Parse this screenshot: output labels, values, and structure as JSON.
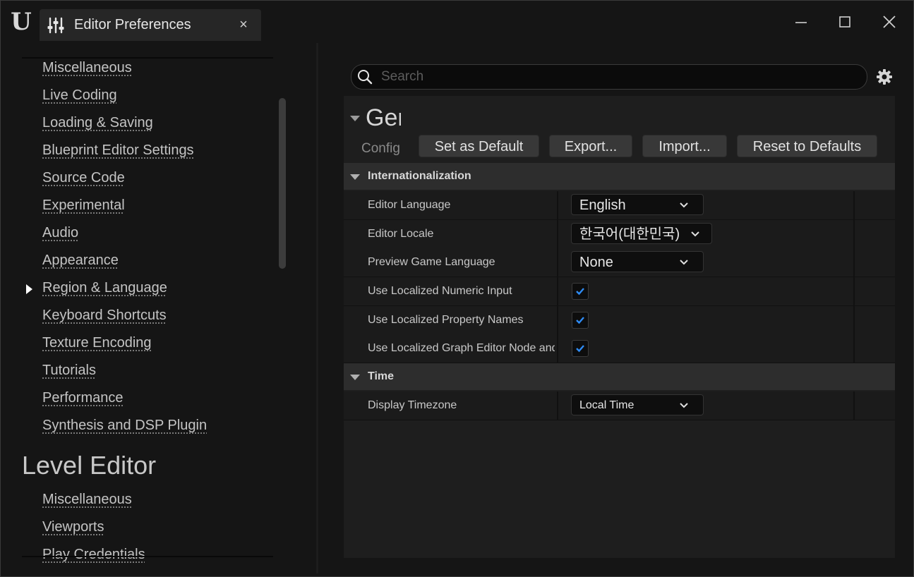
{
  "window": {
    "tab_title": "Editor Preferences",
    "tab_close": "×"
  },
  "nav": {
    "items": [
      "Miscellaneous",
      "Live Coding",
      "Loading & Saving",
      "Blueprint Editor Settings",
      "Source Code",
      "Experimental",
      "Audio",
      "Appearance",
      "Region & Language",
      "Keyboard Shortcuts",
      "Texture Encoding",
      "Tutorials",
      "Performance",
      "Synthesis and DSP Plugin"
    ],
    "selected_item": "Region & Language",
    "level_editor_heading": "Level Editor",
    "level_editor_items": [
      "Miscellaneous",
      "Viewports",
      "Play Credentials"
    ]
  },
  "search": {
    "placeholder": "Search"
  },
  "section": {
    "title": "General",
    "subtitle": "Config"
  },
  "buttons": {
    "set_default": "Set as Default",
    "export": "Export...",
    "import": "Import...",
    "reset": "Reset to Defaults"
  },
  "internationalization": {
    "header": "Internationalization",
    "rows": [
      {
        "name": "Editor Language",
        "value": "English"
      },
      {
        "name": "Editor Locale",
        "value": "한국어(대한민국)"
      },
      {
        "name": "Preview Game Language",
        "value": "None"
      },
      {
        "name": "Use Localized Numeric Input",
        "checked": true
      },
      {
        "name": "Use Localized Property Names",
        "checked": true
      },
      {
        "name": "Use Localized Graph Editor Node and",
        "checked": true
      }
    ]
  },
  "time": {
    "header": "Time",
    "rows": [
      {
        "name": "Display Timezone",
        "value": "Local Time"
      }
    ]
  },
  "colors": {
    "accent_check": "#2f8cf5",
    "background": "#151515",
    "panel": "#1e1e1e"
  }
}
